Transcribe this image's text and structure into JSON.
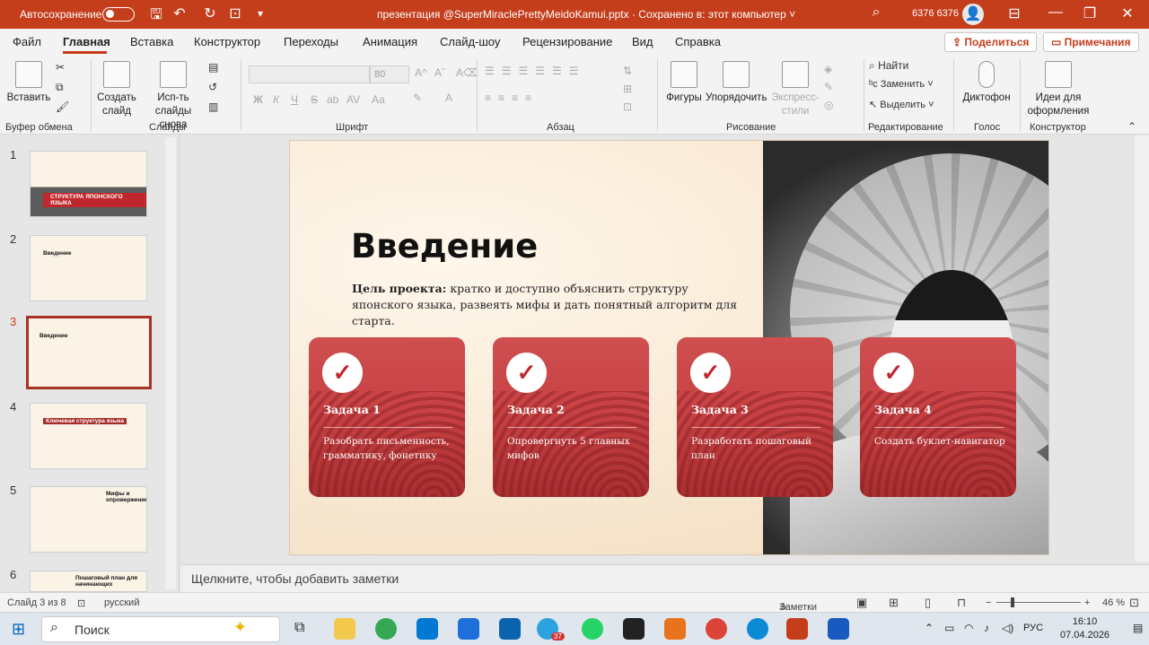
{
  "titlebar": {
    "autosave_label": "Автосохранение",
    "toggle_state": "Откл.",
    "document_title": "презентация @SuperMiraclePrettyMeidoKamui.pptx  ·  Сохранено в: этот компьютер ˅",
    "user_name": "6376 6376",
    "icons": [
      "save-icon",
      "undo-icon",
      "redo-icon",
      "presentation-icon",
      "customize-icon",
      "search-icon",
      "ribbon-display-icon",
      "minimize-icon",
      "restore-icon",
      "close-icon"
    ]
  },
  "menu": {
    "tabs": [
      "Файл",
      "Главная",
      "Вставка",
      "Конструктор",
      "Переходы",
      "Анимация",
      "Слайд-шоу",
      "Рецензирование",
      "Вид",
      "Справка"
    ],
    "active_tab": "Главная",
    "share_label": "Поделиться",
    "comments_label": "Примечания"
  },
  "ribbon": {
    "groups": [
      "Буфер обмена",
      "Слайды",
      "Шрифт",
      "Абзац",
      "Рисование",
      "Редактирование",
      "Голос",
      "Конструктор"
    ],
    "paste": "Вставить",
    "new_slide": "Создать слайд",
    "reuse": "Исп-ть слайды снова",
    "font_size": "80",
    "font_buttons": [
      "Ж",
      "К",
      "Ч",
      "S",
      "ab",
      "AV",
      "Aa"
    ],
    "shapes": "Фигуры",
    "arrange": "Упорядочить",
    "quick_styles": "Экспресс-стили",
    "find": "Найти",
    "replace": "Заменить",
    "select": "Выделить",
    "dictate": "Диктофон",
    "designer": "Идеи для оформления"
  },
  "thumbnails": [
    {
      "num": "1",
      "title": "СТРУКТУРА ЯПОНСКОГО ЯЗЫКА"
    },
    {
      "num": "2",
      "title": "Введение"
    },
    {
      "num": "3",
      "title": "Введение",
      "selected": true
    },
    {
      "num": "4",
      "title": "Ключевая структура языка"
    },
    {
      "num": "5",
      "title": "Мифы и опровержения"
    },
    {
      "num": "6",
      "title": "Пошаговый план для начинающих"
    }
  ],
  "slide": {
    "title": "Введение",
    "intro_bold": "Цель проекта:",
    "intro_text": " кратко и доступно объяснить структуру японского языка, развеять мифы и дать понятный алгоритм для старта.",
    "cards": [
      {
        "title": "Задача 1",
        "text": "Разобрать письменность, грамматику, фонетику"
      },
      {
        "title": "Задача 2",
        "text": "Опровергнуть 5 главных мифов"
      },
      {
        "title": "Задача 3",
        "text": "Разработать пошаговый план"
      },
      {
        "title": "Задача 4",
        "text": "Создать буклет-навигатор"
      }
    ]
  },
  "notes_placeholder": "Щелкните, чтобы добавить заметки",
  "status": {
    "slide_counter": "Слайд 3 из 8",
    "language": "русский",
    "notes_button": "Заметки",
    "zoom": "46 %"
  },
  "taskbar": {
    "search": "Поиск",
    "telegram_badge": "37",
    "lang": "РУС",
    "time": "16:10",
    "date": "07.04.2026"
  },
  "colors": {
    "accent": "#c43e1c",
    "card": "#c84244",
    "slide_bg": "#fbefdf"
  }
}
